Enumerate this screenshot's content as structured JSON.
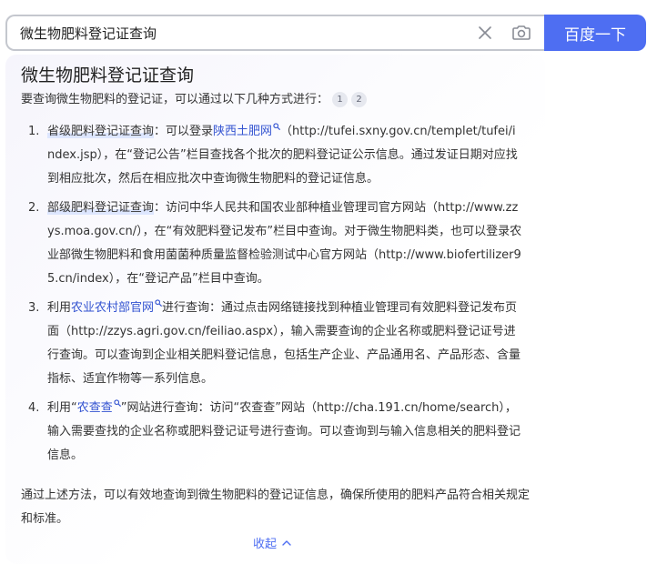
{
  "search": {
    "query": "微生物肥料登记证查询",
    "button_label": "百度一下"
  },
  "answer": {
    "title": "微生物肥料登记证查询",
    "intro": "要查询微生物肥料的登记证，可以通过以下几种方式进行：",
    "citations": [
      "1",
      "2"
    ],
    "methods": [
      {
        "num": "1.",
        "label": "省级肥料登记证查询",
        "before": "：可以登录",
        "link": "陕西土肥网",
        "after": "（http://tufei.sxny.gov.cn/templet/tufei/index.jsp），在“登记公告”栏目查找各个批次的肥料登记证公示信息。通过发证日期对应找到相应批次，然后在相应批次中查询微生物肥料的登记证信息。"
      },
      {
        "num": "2.",
        "label": "部级肥料登记证查询",
        "text": "：访问中华人民共和国农业部种植业管理司官方网站（http://www.zzys.moa.gov.cn/），在“有效肥料登记发布”栏目中查询。对于微生物肥料类，也可以登录农业部微生物肥料和食用菌菌种质量监督检验测试中心官方网站（http://www.biofertilizer95.cn/index），在“登记产品”栏目中查询。"
      },
      {
        "num": "3.",
        "before": "利用",
        "link": "农业农村部官网",
        "after": "进行查询：通过点击网络链接找到种植业管理司有效肥料登记发布页面（http://zzys.agri.gov.cn/feiliao.aspx），输入需要查询的企业名称或肥料登记证号进行查询。可以查询到企业相关肥料登记信息，包括生产企业、产品通用名、产品形态、含量指标、适宜作物等一系列信息。"
      },
      {
        "num": "4.",
        "before": "利用“",
        "link": "农查查",
        "after": "”网站进行查询：访问“农查查”网站（http://cha.191.cn/home/search），输入需要查找的企业名称或肥料登记证号进行查询。可以查询到与输入信息相关的肥料登记信息。"
      }
    ],
    "conclusion": "通过上述方法，可以有效地查询到微生物肥料的登记证信息，确保所使用的肥料产品符合相关规定和标准。",
    "collapse_label": "收起"
  },
  "icons": {
    "clear": "close-icon",
    "camera": "camera-icon",
    "link_search": "search-icon",
    "collapse": "chevron-up-icon"
  },
  "colors": {
    "brand": "#4e6ef2",
    "link": "#3454d1",
    "citation_bg": "#e6e8ef"
  }
}
